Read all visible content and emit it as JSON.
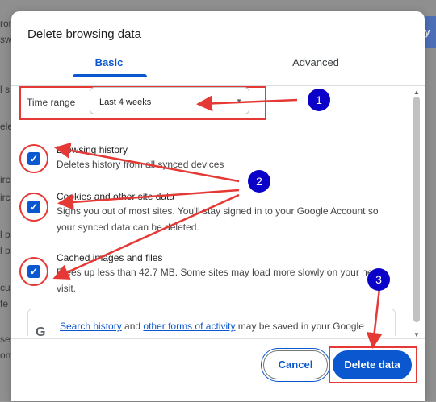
{
  "background": {
    "fragments": [
      "ron",
      "sw",
      "l s",
      "ele",
      "irc",
      "irc",
      "l p",
      "l p",
      "cu",
      "fe",
      "se",
      "ont"
    ],
    "right_button": "ety"
  },
  "dialog": {
    "title": "Delete browsing data",
    "tabs": [
      {
        "label": "Basic",
        "active": true
      },
      {
        "label": "Advanced",
        "active": false
      }
    ],
    "time_range": {
      "label": "Time range",
      "value": "Last 4 weeks"
    },
    "items": [
      {
        "title": "Browsing history",
        "description": "Deletes history from all synced devices",
        "checked": true
      },
      {
        "title": "Cookies and other site data",
        "description": "Signs you out of most sites. You'll stay signed in to your Google Account so your synced data can be deleted.",
        "checked": true
      },
      {
        "title": "Cached images and files",
        "description": "Frees up less than 42.7 MB. Some sites may load more slowly on your next visit.",
        "checked": true
      }
    ],
    "info": {
      "link1": "Search history",
      "mid1": " and ",
      "link2": "other forms of activity",
      "rest": " may be saved in your Google Account when you're signed in. You can delete them anytime."
    },
    "buttons": {
      "cancel": "Cancel",
      "delete": "Delete data"
    }
  },
  "annotations": [
    "1",
    "2",
    "3"
  ],
  "colors": {
    "accent": "#0b57d0",
    "annotation_red": "#e53935",
    "badge_blue": "#0a00c8"
  }
}
